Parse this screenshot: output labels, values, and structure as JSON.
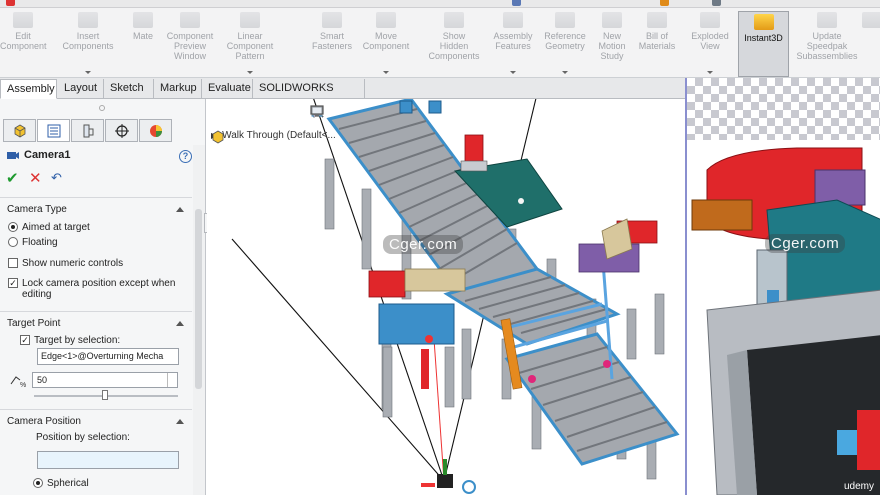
{
  "ribbon": {
    "items": [
      {
        "label": "Edit\nComponent"
      },
      {
        "label": "Insert\nComponents"
      },
      {
        "label": "Mate"
      },
      {
        "label": "Component\nPreview\nWindow"
      },
      {
        "label": "Linear Component\nPattern"
      },
      {
        "label": "Smart\nFasteners"
      },
      {
        "label": "Move\nComponent"
      },
      {
        "label": "Show\nHidden\nComponents"
      },
      {
        "label": "Assembly\nFeatures"
      },
      {
        "label": "Reference\nGeometry"
      },
      {
        "label": "New\nMotion\nStudy"
      },
      {
        "label": "Bill of\nMaterials"
      },
      {
        "label": "Exploded\nView"
      },
      {
        "label": "Instant3D"
      },
      {
        "label": "Update\nSpeedpak\nSubassemblies"
      }
    ]
  },
  "tabs": [
    "Assembly",
    "Layout",
    "Sketch",
    "Markup",
    "Evaluate",
    "SOLIDWORKS Add-Ins"
  ],
  "property_manager": {
    "title": "Camera1",
    "help": "?",
    "ok_icon": "✔",
    "cancel_icon": "✕",
    "undo_icon": "↶",
    "camera_type": {
      "header": "Camera Type",
      "aimed": "Aimed at target",
      "floating": "Floating",
      "show_numeric": "Show numeric controls",
      "lock_position": "Lock camera position except when editing"
    },
    "target_point": {
      "header": "Target Point",
      "target_by_selection": "Target by selection:",
      "selection": "Edge<1>@Overturning Mecha",
      "value": "50"
    },
    "camera_position": {
      "header": "Camera Position",
      "position_by_selection": "Position by selection:",
      "spherical": "Spherical"
    }
  },
  "graphics": {
    "tree_label": "Walk Through  (Default<...",
    "watermark": "Cger.com",
    "colors": {
      "conveyor": "#3c8fc9",
      "frame": "#a8acb2",
      "motor": "#e0262a",
      "teal": "#1f6f6a"
    }
  },
  "camera_view": {
    "watermark": "Cger.com",
    "brand": "udemy"
  }
}
